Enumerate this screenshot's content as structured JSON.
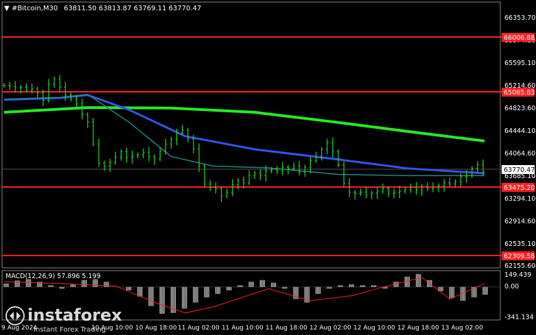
{
  "header": {
    "arrow": "▼",
    "symbol": "#Bitcoin,M30",
    "ohlc": "63811.50 63813.87 63769.11 63770.47"
  },
  "colors": {
    "background": "#000000",
    "price_bars": "#22dd22",
    "ma_slow": "#22ee22",
    "ma_mid": "#3355ee",
    "ma_fast": "#228888",
    "level_line": "#ff2020",
    "macd_histogram": "#c0c0c0",
    "macd_signal": "#ff2020",
    "axis_text": "#ffffff"
  },
  "chart_data": [
    {
      "type": "line",
      "title": "",
      "x_labels": [
        "9 Aug 2024",
        "10 Aug 10:00",
        "10 Aug 18:00",
        "11 Aug 02:00",
        "11 Aug 10:00",
        "11 Aug 18:00",
        "12 Aug 02:00",
        "12 Aug 10:00",
        "12 Aug 18:00",
        "13 Aug 02:00"
      ],
      "ylim": [
        62155.6,
        66400
      ],
      "y_ticks": [
        "66353.70",
        "65974.80",
        "65595.10",
        "65214.60",
        "64823.60",
        "64444.10",
        "64064.60",
        "63685.10",
        "63294.10",
        "62914.60",
        "62535.10",
        "62155.60"
      ],
      "current_price": "63770.47",
      "horizontal_levels": [
        {
          "label": "66006.88",
          "value": 66006.88
        },
        {
          "label": "65065.83",
          "value": 65065.83
        },
        {
          "label": "63475.20",
          "value": 63475.2
        },
        {
          "label": "62309.58",
          "value": 62309.58
        }
      ],
      "price_series": {
        "x": [
          0,
          4,
          8,
          12,
          16,
          20,
          24,
          28,
          32,
          36,
          40,
          44,
          48,
          52,
          56,
          60,
          64,
          68,
          72,
          76,
          80,
          84,
          88,
          92,
          96,
          100,
          104,
          108,
          112,
          116,
          120,
          124,
          128,
          132,
          136,
          140,
          144,
          148,
          152,
          156,
          160,
          164,
          168,
          172,
          176,
          180,
          184,
          188,
          192,
          196,
          200,
          204,
          208,
          212,
          216,
          220,
          224,
          228,
          232,
          236,
          240,
          244,
          248,
          252,
          256,
          260,
          264,
          268,
          272,
          276,
          280,
          284,
          288,
          292,
          296,
          300,
          304,
          308,
          312,
          316,
          320,
          324,
          328,
          332,
          336,
          340,
          344
        ],
        "close": [
          65210,
          65195,
          65170,
          65180,
          65130,
          65150,
          65080,
          64960,
          65230,
          65320,
          65180,
          65050,
          64980,
          64900,
          64720,
          64600,
          64230,
          63910,
          63860,
          63920,
          64010,
          64100,
          64000,
          64030,
          64050,
          64090,
          64020,
          63980,
          64110,
          64230,
          64310,
          64420,
          64460,
          64320,
          64150,
          63860,
          63560,
          63500,
          63480,
          63360,
          63420,
          63550,
          63620,
          63580,
          63700,
          63740,
          63700,
          63780,
          63800,
          63780,
          63840,
          63820,
          63860,
          63760,
          63840,
          63950,
          64010,
          64140,
          64250,
          64100,
          63880,
          63570,
          63420,
          63400,
          63420,
          63380,
          63410,
          63440,
          63480,
          63400,
          63420,
          63440,
          63470,
          63500,
          63460,
          63520,
          63480,
          63500,
          63530,
          63580,
          63560,
          63600,
          63680,
          63700,
          63820,
          63880,
          63770.47
        ]
      },
      "moving_averages": [
        {
          "x": [
            0,
            60,
            120,
            180,
            240,
            300,
            345
          ],
          "values": [
            64760,
            64840,
            64830,
            64760,
            64590,
            64410,
            64280
          ]
        },
        {
          "x": [
            0,
            40,
            60,
            90,
            130,
            180,
            240,
            290,
            345
          ],
          "values": [
            64970,
            65000,
            65050,
            64800,
            64360,
            64140,
            63970,
            63820,
            63740
          ]
        },
        {
          "x": [
            0,
            40,
            60,
            90,
            120,
            150,
            190,
            240,
            290,
            345
          ],
          "values": [
            64980,
            65010,
            65060,
            64590,
            64020,
            63860,
            63830,
            63720,
            63700,
            63700
          ]
        }
      ]
    },
    {
      "type": "bar",
      "title": "MACD(12,26,9) 57.896 5.199",
      "ylim": [
        -341.134,
        149.439
      ],
      "y_ticks": [
        "149.439",
        "0.00",
        "-341.134"
      ],
      "histogram": {
        "x": [
          0,
          8,
          16,
          24,
          32,
          40,
          48,
          56,
          64,
          72,
          80,
          88,
          96,
          104,
          112,
          120,
          128,
          136,
          144,
          152,
          160,
          168,
          176,
          184,
          192,
          200,
          208,
          216,
          224,
          232,
          240,
          248,
          256,
          264,
          272,
          280,
          288,
          296,
          304,
          312,
          320,
          328,
          336,
          344
        ],
        "values": [
          40,
          75,
          90,
          60,
          20,
          -20,
          30,
          80,
          90,
          60,
          0,
          -40,
          -110,
          -220,
          -310,
          -300,
          -250,
          -180,
          -120,
          -80,
          -40,
          20,
          60,
          80,
          50,
          -20,
          -140,
          -180,
          -80,
          -20,
          20,
          30,
          20,
          20,
          -20,
          60,
          120,
          150,
          80,
          -50,
          -130,
          -160,
          -120,
          -90
        ]
      },
      "signal": {
        "x": [
          0,
          40,
          80,
          110,
          130,
          150,
          190,
          220,
          250,
          270,
          300,
          320,
          345
        ],
        "values": [
          60,
          40,
          10,
          -190,
          -300,
          -230,
          -20,
          -160,
          -100,
          -10,
          110,
          -140,
          40
        ]
      }
    }
  ],
  "watermark": {
    "brand": "instaforex",
    "tagline": "Instant Forex Trading"
  }
}
